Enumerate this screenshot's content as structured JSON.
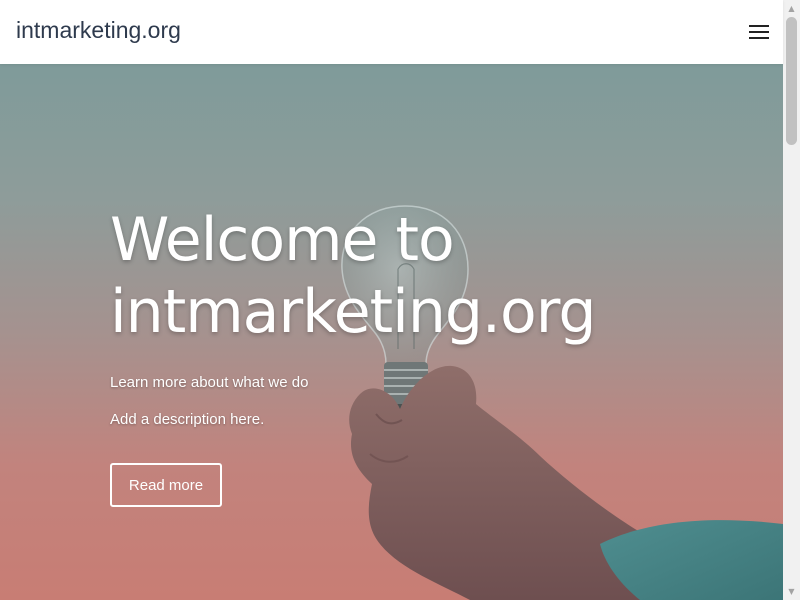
{
  "header": {
    "site_title": "intmarketing.org",
    "menu_icon": "hamburger-menu-icon"
  },
  "hero": {
    "title_line1": "Welcome to",
    "title_line2": "intmarketing.org",
    "subtitle": "Learn more about what we do",
    "description": "Add a description here.",
    "button_label": "Read more",
    "image_subject": "hand holding light bulb"
  },
  "scrollbar": {
    "up_icon": "scroll-up-arrow-icon",
    "down_icon": "scroll-down-arrow-icon"
  },
  "colors": {
    "header_bg": "#ffffff",
    "site_title": "#2e3a4d",
    "hero_top": "#7f9b9a",
    "hero_bottom": "#c87d74",
    "hero_text": "#ffffff",
    "scrollbar_track": "#f1f1f1",
    "scrollbar_thumb": "#c1c1c1"
  }
}
